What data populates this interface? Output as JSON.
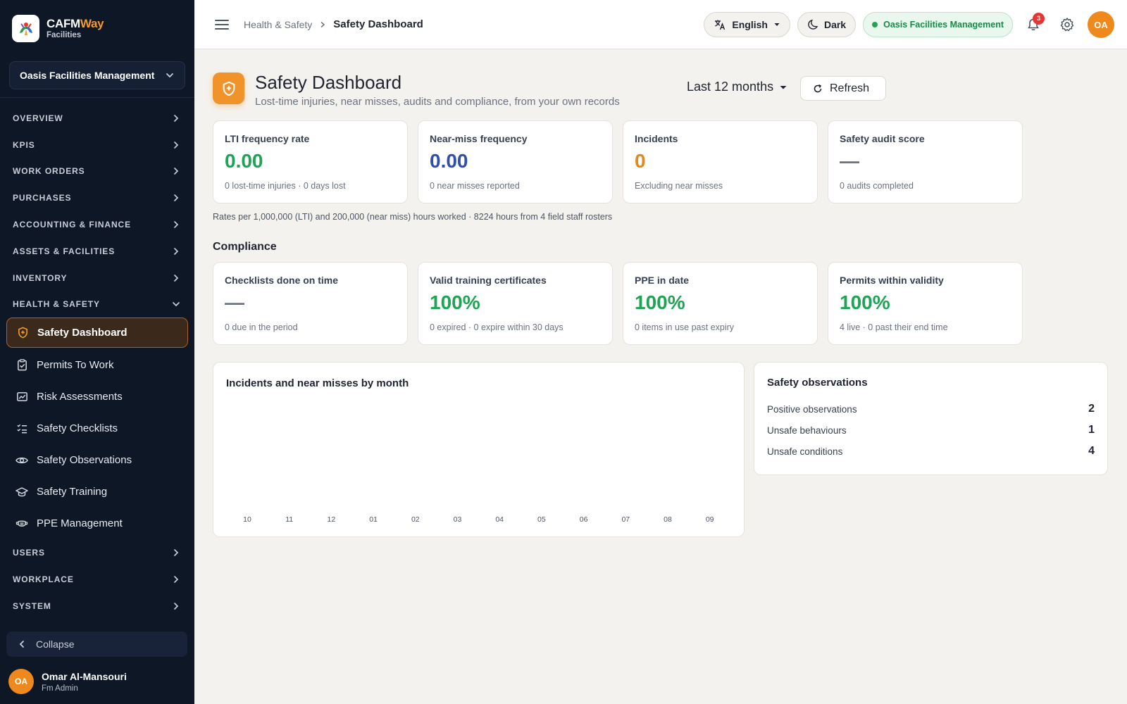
{
  "brand": {
    "name_main": "CAFM",
    "name_accent": "Way",
    "subtitle": "Facilities"
  },
  "sidebar": {
    "org_selector": "Oasis Facilities Management",
    "sections": [
      "OVERVIEW",
      "KPIS",
      "WORK ORDERS",
      "PURCHASES",
      "ACCOUNTING & FINANCE",
      "ASSETS & FACILITIES",
      "INVENTORY"
    ],
    "expanded_section": "HEALTH & SAFETY",
    "items": [
      {
        "label": "Safety Dashboard",
        "icon": "shield-icon",
        "active": true
      },
      {
        "label": "Permits To Work",
        "icon": "clipboard-check-icon"
      },
      {
        "label": "Risk Assessments",
        "icon": "image-chart-icon"
      },
      {
        "label": "Safety Checklists",
        "icon": "checklist-icon"
      },
      {
        "label": "Safety Observations",
        "icon": "eye-icon"
      },
      {
        "label": "Safety Training",
        "icon": "graduation-cap-icon"
      },
      {
        "label": "PPE Management",
        "icon": "mask-icon"
      }
    ],
    "sections_after": [
      "USERS",
      "WORKPLACE",
      "SYSTEM"
    ],
    "collapse_label": "Collapse",
    "user": {
      "initials": "OA",
      "name": "Omar Al-Mansouri",
      "role": "Fm Admin"
    }
  },
  "topbar": {
    "breadcrumb_parent": "Health & Safety",
    "breadcrumb_current": "Safety Dashboard",
    "language": "English",
    "theme": "Dark",
    "org": "Oasis Facilities Management",
    "notifications_count": "3",
    "avatar_initials": "OA"
  },
  "page": {
    "title": "Safety Dashboard",
    "subtitle": "Lost-time injuries, near misses, audits and compliance, from your own records",
    "period": "Last 12 months",
    "refresh_label": "Refresh"
  },
  "kpis": [
    {
      "label": "LTI frequency rate",
      "value": "0.00",
      "note": "0 lost-time injuries · 0 days lost",
      "color": "#1fa355"
    },
    {
      "label": "Near-miss frequency",
      "value": "0.00",
      "note": "0 near misses reported",
      "color": "#2f4fb0"
    },
    {
      "label": "Incidents",
      "value": "0",
      "note": "Excluding near misses",
      "color": "#e08a20"
    },
    {
      "label": "Safety audit score",
      "value": "—",
      "note": "0 audits completed",
      "color": "#6b7280"
    }
  ],
  "rates_note": "Rates per 1,000,000 (LTI) and 200,000 (near miss) hours worked · 8224 hours from 4 field staff rosters",
  "compliance": {
    "title": "Compliance",
    "cards": [
      {
        "label": "Checklists done on time",
        "value": "—",
        "note": "0 due in the period",
        "color": "#6b7280"
      },
      {
        "label": "Valid training certificates",
        "value": "100%",
        "note": "0 expired · 0 expire within 30 days",
        "color": "#1fa355"
      },
      {
        "label": "PPE in date",
        "value": "100%",
        "note": "0 items in use past expiry",
        "color": "#1fa355"
      },
      {
        "label": "Permits within validity",
        "value": "100%",
        "note": "4 live · 0 past their end time",
        "color": "#1fa355"
      }
    ]
  },
  "chart_data": {
    "type": "bar",
    "title": "Incidents and near misses by month",
    "categories": [
      "10",
      "11",
      "12",
      "01",
      "02",
      "03",
      "04",
      "05",
      "06",
      "07",
      "08",
      "09"
    ],
    "series": [
      {
        "values": [
          0,
          0,
          0,
          0,
          0,
          0,
          0,
          0,
          0,
          0,
          0,
          0
        ]
      }
    ],
    "xlabel": "",
    "ylabel": ""
  },
  "observations": {
    "title": "Safety observations",
    "rows": [
      {
        "label": "Positive observations",
        "value": "2"
      },
      {
        "label": "Unsafe behaviours",
        "value": "1"
      },
      {
        "label": "Unsafe conditions",
        "value": "4"
      }
    ]
  }
}
